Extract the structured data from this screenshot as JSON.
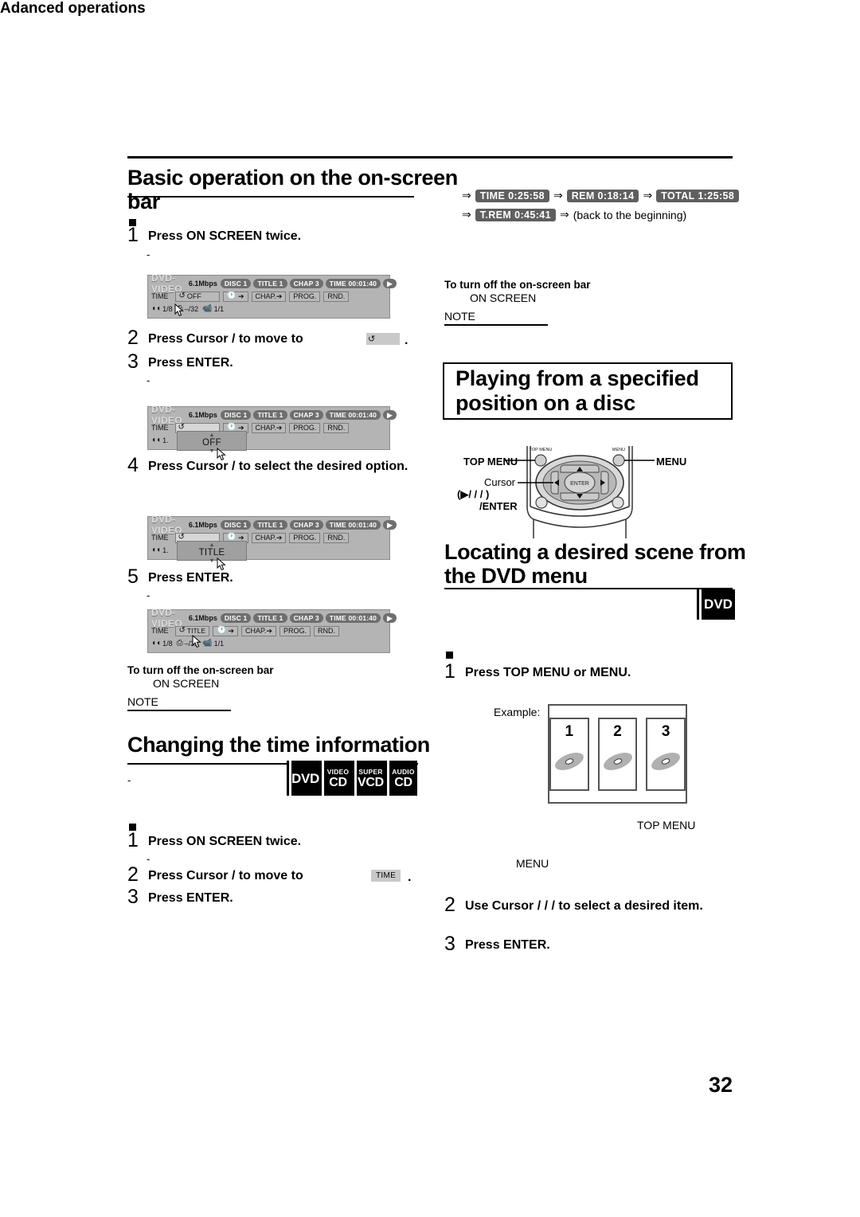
{
  "running_head": "Adanced operations",
  "page_number": "32",
  "left_column": {
    "section1": {
      "heading": "Basic operation on the on-screen bar",
      "steps": [
        {
          "num": "1",
          "text": "Press ON SCREEN twice."
        },
        {
          "num": "2",
          "text": "Press Cursor  /   to move      to"
        },
        {
          "num": "3",
          "text": "Press ENTER."
        },
        {
          "num": "4",
          "text": "Press Cursor   /   to select the desired option."
        },
        {
          "num": "5",
          "text": "Press ENTER."
        }
      ],
      "note": {
        "turn_off_title": "To turn off the on-screen bar",
        "turn_off_body": "ON SCREEN",
        "note_label": "NOTE"
      }
    },
    "section2": {
      "heading": "Changing the time information",
      "badges": [
        {
          "top": "",
          "main": "DVD"
        },
        {
          "top": "VIDEO",
          "main": "CD"
        },
        {
          "top": "SUPER",
          "main": "VCD"
        },
        {
          "top": "AUDIO",
          "main": "CD"
        }
      ],
      "steps": [
        {
          "num": "1",
          "text": "Press ON SCREEN twice."
        },
        {
          "num": "2",
          "text": "Press Cursor   /    to move       to"
        },
        {
          "num": "3",
          "text": "Press ENTER."
        }
      ],
      "time_chip_label": "TIME"
    }
  },
  "osb_bars": [
    {
      "id": "osb-1",
      "disc_type": "DVD-VIDEO",
      "bitrate": "6.1Mbps",
      "chips": [
        {
          "label": "DISC 1"
        },
        {
          "label": "TITLE  1"
        },
        {
          "label": "CHAP  3"
        },
        {
          "label": "TIME 00:01:40"
        }
      ],
      "row2": [
        {
          "kind": "text",
          "label": "TIME"
        },
        {
          "kind": "repeat-field",
          "label": "OFF"
        },
        {
          "kind": "timearrow"
        },
        {
          "kind": "btn",
          "label": "CHAP."
        },
        {
          "kind": "btn",
          "label": "PROG."
        },
        {
          "kind": "btn",
          "label": "RND."
        }
      ],
      "row3": [
        {
          "icon": "audio-icon",
          "label": "1/8"
        },
        {
          "icon": "subtitle-icon",
          "label": "–/32"
        },
        {
          "icon": "angle-icon",
          "label": "1/1"
        }
      ],
      "dropdown": null,
      "cursor_at": "repeat"
    },
    {
      "id": "osb-2",
      "disc_type": "DVD-VIDEO",
      "bitrate": "6.1Mbps",
      "chips": [
        {
          "label": "DISC 1"
        },
        {
          "label": "TITLE  1"
        },
        {
          "label": "CHAP  3"
        },
        {
          "label": "TIME 00:01:40"
        }
      ],
      "row2": [
        {
          "kind": "text",
          "label": "TIME"
        },
        {
          "kind": "repeat-field",
          "label": ""
        },
        {
          "kind": "timearrow"
        },
        {
          "kind": "btn",
          "label": "CHAP."
        },
        {
          "kind": "btn",
          "label": "PROG."
        },
        {
          "kind": "btn",
          "label": "RND."
        }
      ],
      "row3": [
        {
          "icon": "audio-icon",
          "label": "1."
        },
        {
          "icon": "angle-icon",
          "label": "1/1"
        }
      ],
      "dropdown": {
        "value": "OFF"
      },
      "cursor_at": "dropdown"
    },
    {
      "id": "osb-3",
      "disc_type": "DVD-VIDEO",
      "bitrate": "6.1Mbps",
      "chips": [
        {
          "label": "DISC 1"
        },
        {
          "label": "TITLE  1"
        },
        {
          "label": "CHAP  3"
        },
        {
          "label": "TIME 00:01:40"
        }
      ],
      "row2": [
        {
          "kind": "text",
          "label": "TIME"
        },
        {
          "kind": "repeat-field",
          "label": ""
        },
        {
          "kind": "timearrow"
        },
        {
          "kind": "btn",
          "label": "CHAP."
        },
        {
          "kind": "btn",
          "label": "PROG."
        },
        {
          "kind": "btn",
          "label": "RND."
        }
      ],
      "row3": [
        {
          "icon": "audio-icon",
          "label": "1."
        },
        {
          "icon": "angle-icon",
          "label": "1/1"
        }
      ],
      "dropdown": {
        "value": "TITLE"
      },
      "cursor_at": "dropdown"
    },
    {
      "id": "osb-4",
      "disc_type": "DVD-VIDEO",
      "bitrate": "6.1Mbps",
      "chips": [
        {
          "label": "DISC 1"
        },
        {
          "label": "TITLE  1"
        },
        {
          "label": "CHAP  3"
        },
        {
          "label": "TIME 00:01:40"
        }
      ],
      "row2": [
        {
          "kind": "text",
          "label": "TIME"
        },
        {
          "kind": "repeat-set",
          "label": "TITLE"
        },
        {
          "kind": "timearrow"
        },
        {
          "kind": "btn",
          "label": "CHAP."
        },
        {
          "kind": "btn",
          "label": "PROG."
        },
        {
          "kind": "btn",
          "label": "RND."
        }
      ],
      "row3": [
        {
          "icon": "audio-icon",
          "label": "1/8"
        },
        {
          "icon": "subtitle-icon",
          "label": "–/32"
        },
        {
          "icon": "angle-icon",
          "label": "1/1"
        }
      ],
      "dropdown": null,
      "cursor_at": "timearrow"
    }
  ],
  "right_column": {
    "time_sequence": {
      "line1": [
        {
          "type": "arrow",
          "text": "⇒"
        },
        {
          "type": "chip",
          "text": "TIME  0:25:58"
        },
        {
          "type": "arrow",
          "text": "⇒"
        },
        {
          "type": "chip",
          "text": "REM  0:18:14"
        },
        {
          "type": "arrow",
          "text": "⇒"
        },
        {
          "type": "chip",
          "text": "TOTAL  1:25:58"
        }
      ],
      "line2": [
        {
          "type": "arrow",
          "text": "⇒"
        },
        {
          "type": "chip",
          "text": "T.REM 0:45:41"
        },
        {
          "type": "arrow",
          "text": "⇒"
        },
        {
          "type": "plain",
          "text": "(back to the beginning)"
        }
      ]
    },
    "note": {
      "turn_off_title": "To turn off the on-screen bar",
      "turn_off_body": "ON SCREEN",
      "note_label": "NOTE"
    },
    "title_box": "Playing from a specified position on a disc",
    "remote": {
      "left_label": "TOP MENU",
      "right_label": "MENU",
      "cursor_label": "Cursor",
      "cursor_sub1": "(▶/   /   /   )",
      "cursor_sub2": "/ENTER",
      "btn_top_menu": "TOP MENU",
      "btn_menu": "MENU",
      "enter_label": "ENTER"
    },
    "section_heading": "Locating a desired scene from the DVD menu",
    "dvd_badge": "DVD",
    "steps": [
      {
        "num": "1",
        "text": "Press TOP MENU or MENU."
      },
      {
        "num": "2",
        "text": "Use Cursor   /  /  /   to select a desired item."
      },
      {
        "num": "3",
        "text": "Press ENTER."
      }
    ],
    "example_label": "Example:",
    "menu_cells": [
      "1",
      "2",
      "3"
    ],
    "callout_top_menu": "TOP MENU",
    "callout_menu": "MENU"
  }
}
